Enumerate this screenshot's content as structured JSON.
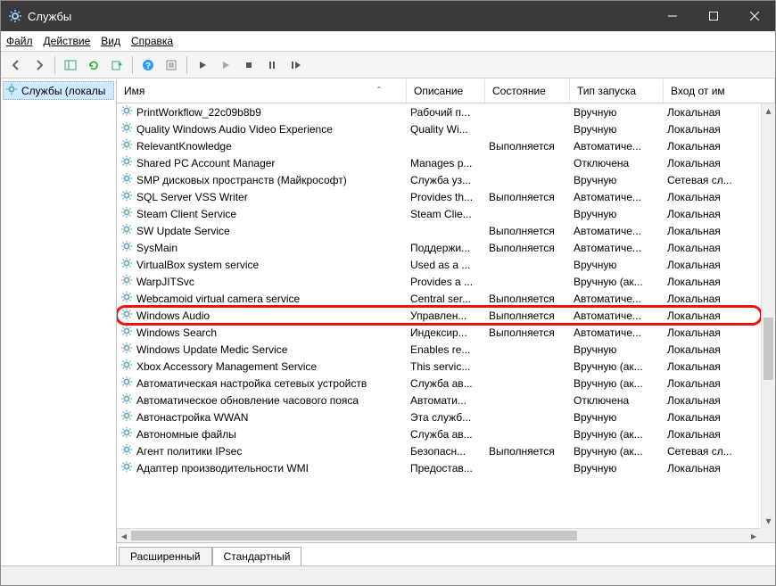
{
  "title": "Службы",
  "menubar": {
    "file": "Файл",
    "action": "Действие",
    "view": "Вид",
    "help": "Справка"
  },
  "sidebar": {
    "root": "Службы (локалы"
  },
  "columns": {
    "name": "Имя",
    "desc": "Описание",
    "state": "Состояние",
    "start": "Тип запуска",
    "logon": "Вход от им"
  },
  "tabs": {
    "extended": "Расширенный",
    "standard": "Стандартный"
  },
  "rows": [
    {
      "name": "PrintWorkflow_22c09b8b9",
      "desc": "Рабочий п...",
      "state": "",
      "start": "Вручную",
      "logon": "Локальная"
    },
    {
      "name": "Quality Windows Audio Video Experience",
      "desc": "Quality Wi...",
      "state": "",
      "start": "Вручную",
      "logon": "Локальная"
    },
    {
      "name": "RelevantKnowledge",
      "desc": "",
      "state": "Выполняется",
      "start": "Автоматиче...",
      "logon": "Локальная"
    },
    {
      "name": "Shared PC Account Manager",
      "desc": "Manages p...",
      "state": "",
      "start": "Отключена",
      "logon": "Локальная"
    },
    {
      "name": "SMP дисковых пространств (Майкрософт)",
      "desc": "Служба уз...",
      "state": "",
      "start": "Вручную",
      "logon": "Сетевая сл..."
    },
    {
      "name": "SQL Server VSS Writer",
      "desc": "Provides th...",
      "state": "Выполняется",
      "start": "Автоматиче...",
      "logon": "Локальная"
    },
    {
      "name": "Steam Client Service",
      "desc": "Steam Clie...",
      "state": "",
      "start": "Вручную",
      "logon": "Локальная"
    },
    {
      "name": "SW Update Service",
      "desc": "",
      "state": "Выполняется",
      "start": "Автоматиче...",
      "logon": "Локальная"
    },
    {
      "name": "SysMain",
      "desc": "Поддержи...",
      "state": "Выполняется",
      "start": "Автоматиче...",
      "logon": "Локальная"
    },
    {
      "name": "VirtualBox system service",
      "desc": "Used as a ...",
      "state": "",
      "start": "Вручную",
      "logon": "Локальная"
    },
    {
      "name": "WarpJITSvc",
      "desc": "Provides a ...",
      "state": "",
      "start": "Вручную (ак...",
      "logon": "Локальная"
    },
    {
      "name": "Webcamoid virtual camera service",
      "desc": "Central ser...",
      "state": "Выполняется",
      "start": "Автоматиче...",
      "logon": "Локальная"
    },
    {
      "name": "Windows Audio",
      "desc": "Управлен...",
      "state": "Выполняется",
      "start": "Автоматиче...",
      "logon": "Локальная",
      "hl": true
    },
    {
      "name": "Windows Search",
      "desc": "Индексир...",
      "state": "Выполняется",
      "start": "Автоматиче...",
      "logon": "Локальная"
    },
    {
      "name": "Windows Update Medic Service",
      "desc": "Enables re...",
      "state": "",
      "start": "Вручную",
      "logon": "Локальная"
    },
    {
      "name": "Xbox Accessory Management Service",
      "desc": "This servic...",
      "state": "",
      "start": "Вручную (ак...",
      "logon": "Локальная"
    },
    {
      "name": "Автоматическая настройка сетевых устройств",
      "desc": "Служба ав...",
      "state": "",
      "start": "Вручную (ак...",
      "logon": "Локальная"
    },
    {
      "name": "Автоматическое обновление часового пояса",
      "desc": "Автомати...",
      "state": "",
      "start": "Отключена",
      "logon": "Локальная"
    },
    {
      "name": "Автонастройка WWAN",
      "desc": "Эта служб...",
      "state": "",
      "start": "Вручную",
      "logon": "Локальная"
    },
    {
      "name": "Автономные файлы",
      "desc": "Служба ав...",
      "state": "",
      "start": "Вручную (ак...",
      "logon": "Локальная"
    },
    {
      "name": "Агент политики IPsec",
      "desc": "Безопасн...",
      "state": "Выполняется",
      "start": "Вручную (ак...",
      "logon": "Сетевая сл..."
    },
    {
      "name": "Адаптер производительности WMI",
      "desc": "Предостав...",
      "state": "",
      "start": "Вручную",
      "logon": "Локальная"
    }
  ]
}
